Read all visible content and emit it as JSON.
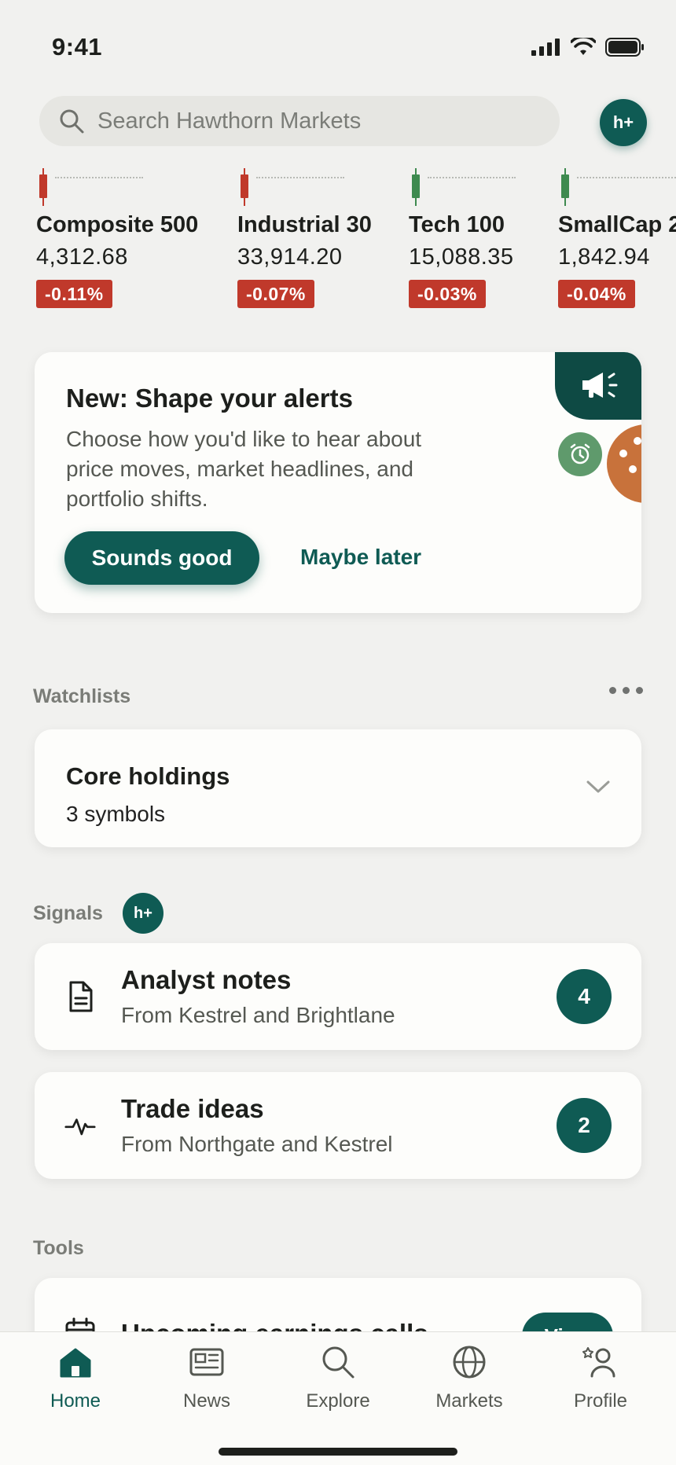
{
  "status": {
    "time": "9:41"
  },
  "search": {
    "placeholder": "Search Hawthorn Markets",
    "icon": "search-icon"
  },
  "profile_badge": "h+",
  "tickers": [
    {
      "name": "Composite 500",
      "value": "4,312.68",
      "change": "-0.11%",
      "candle_color": "#c0392b"
    },
    {
      "name": "Industrial 30",
      "value": "33,914.20",
      "change": "-0.07%",
      "candle_color": "#c0392b"
    },
    {
      "name": "Tech 100",
      "value": "15,088.35",
      "change": "-0.03%",
      "candle_color": "#3e8a4f"
    },
    {
      "name": "SmallCap 2",
      "value": "1,842.94",
      "change": "-0.04%",
      "candle_color": "#3e8a4f"
    }
  ],
  "alerts_card": {
    "title": "New: Shape your alerts",
    "description": "Choose how you'd like to hear about price moves, market headlines, and portfolio shifts.",
    "primary_button": "Sounds good",
    "secondary_button": "Maybe later"
  },
  "watchlists": {
    "label": "Watchlists",
    "card": {
      "title": "Core holdings",
      "subtitle": "3 symbols"
    }
  },
  "signals": {
    "label": "Signals",
    "badge": "h+",
    "items": [
      {
        "title": "Analyst notes",
        "subtitle": "From Kestrel and Brightlane",
        "count": "4",
        "icon": "document-icon"
      },
      {
        "title": "Trade ideas",
        "subtitle": "From Northgate and Kestrel",
        "count": "2",
        "icon": "pulse-icon"
      }
    ]
  },
  "tools": {
    "label": "Tools",
    "card": {
      "title": "Upcoming earnings calls",
      "button": "View",
      "icon": "calendar-icon"
    }
  },
  "tabbar": {
    "active": "Home",
    "items": [
      {
        "label": "Home",
        "icon": "home-icon"
      },
      {
        "label": "News",
        "icon": "news-icon"
      },
      {
        "label": "Explore",
        "icon": "search-icon"
      },
      {
        "label": "Markets",
        "icon": "globe-icon"
      },
      {
        "label": "Profile",
        "icon": "profile-icon"
      }
    ]
  },
  "colors": {
    "accent": "#0f5b54",
    "negative": "#c0392b",
    "positive": "#3e8a4f",
    "background": "#f1f1ef"
  }
}
